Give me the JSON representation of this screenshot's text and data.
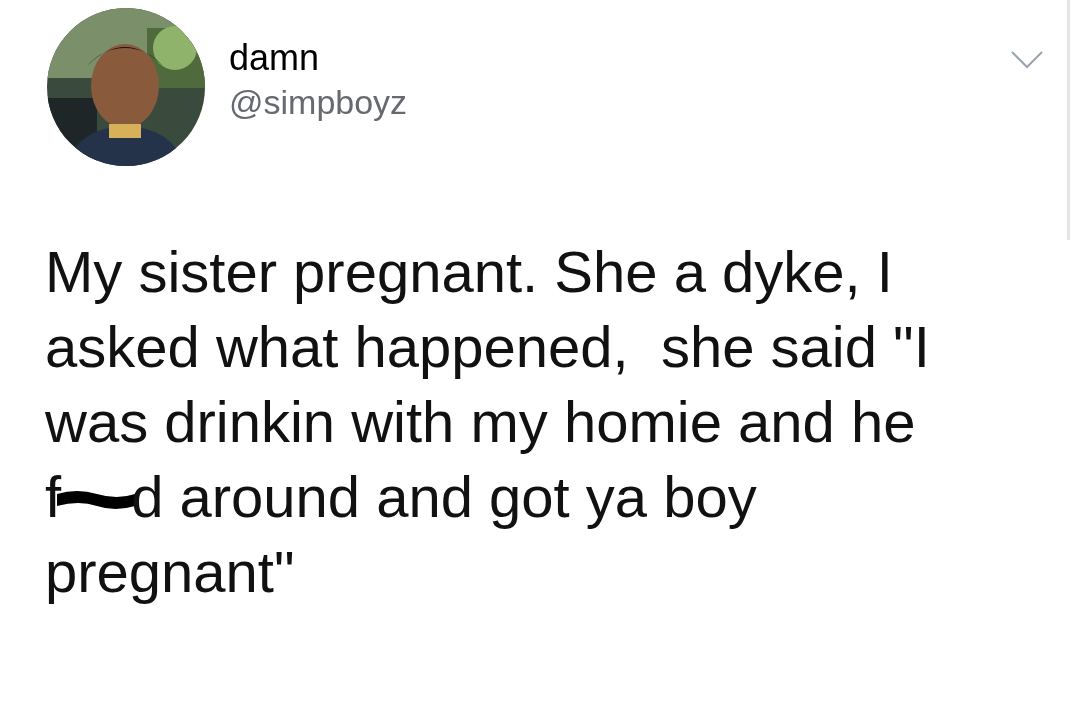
{
  "tweet": {
    "author": {
      "name": "damn",
      "handle": "@simpboyz"
    },
    "lines": [
      {
        "kind": "text",
        "text": "My sister pregnant. She a dyke, I"
      },
      {
        "kind": "text",
        "text": "asked what happened,  she said \"I"
      },
      {
        "kind": "text",
        "text": "was drinkin with my homie and he"
      },
      {
        "kind": "redacted",
        "before": "f",
        "after": "d",
        "rest": "around and got ya boy"
      },
      {
        "kind": "text",
        "text": "pregnant\""
      }
    ]
  }
}
